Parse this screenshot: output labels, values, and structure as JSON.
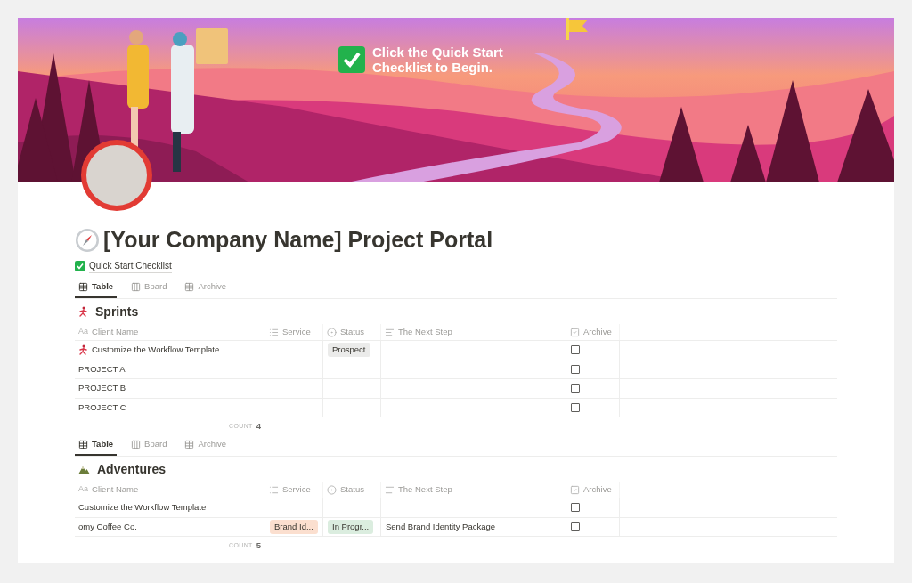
{
  "banner": {
    "caption": "Click the Quick Start Checklist to Begin."
  },
  "title": "[Your Company Name] Project Portal",
  "checklist_link": "Quick Start Checklist",
  "sections": [
    {
      "views": [
        {
          "label": "Table",
          "kind": "table",
          "selected": true
        },
        {
          "label": "Board",
          "kind": "board",
          "selected": false
        },
        {
          "label": "Archive",
          "kind": "table",
          "selected": false
        }
      ],
      "heading": "Sprints",
      "kind": "runner",
      "columns": [
        {
          "label": "Client Name",
          "kind": "title",
          "glyph": "Aa"
        },
        {
          "label": "Service",
          "kind": "multi_select"
        },
        {
          "label": "Status",
          "kind": "select"
        },
        {
          "label": "The Next Step",
          "kind": "text"
        },
        {
          "label": "Archive",
          "kind": "checkbox"
        }
      ],
      "rows": [
        {
          "client_name": "Customize the Workflow Template",
          "kind": "runner",
          "status": {
            "text": "Prospect",
            "color": "#ebebea"
          },
          "archived": false
        },
        {
          "client_name": "PROJECT A",
          "kind": "plain",
          "archived": false
        },
        {
          "client_name": "PROJECT B",
          "kind": "plain",
          "archived": false
        },
        {
          "client_name": "PROJECT C",
          "kind": "plain",
          "archived": false
        }
      ],
      "count_label": "COUNT",
      "count": "4"
    },
    {
      "views": [
        {
          "label": "Table",
          "kind": "table",
          "selected": true
        },
        {
          "label": "Board",
          "kind": "board",
          "selected": false
        },
        {
          "label": "Archive",
          "kind": "table",
          "selected": false
        }
      ],
      "heading": "Adventures",
      "kind": "mountain",
      "columns": [
        {
          "label": "Client Name",
          "kind": "title",
          "glyph": "Aa"
        },
        {
          "label": "Service",
          "kind": "multi_select"
        },
        {
          "label": "Status",
          "kind": "select"
        },
        {
          "label": "The Next Step",
          "kind": "text"
        },
        {
          "label": "Archive",
          "kind": "checkbox"
        }
      ],
      "rows": [
        {
          "client_name": "Customize the Workflow Template",
          "kind": "plain",
          "archived": false
        },
        {
          "client_name": "omy Coffee Co.",
          "kind": "plain",
          "service": {
            "text": "Brand Id...",
            "color": "#fbdfcf"
          },
          "status": {
            "text": "In Progr...",
            "color": "#dbeddf"
          },
          "next_step": "Send Brand Identity Package",
          "archived": false
        }
      ],
      "count_label": "COUNT",
      "count": "5"
    }
  ]
}
